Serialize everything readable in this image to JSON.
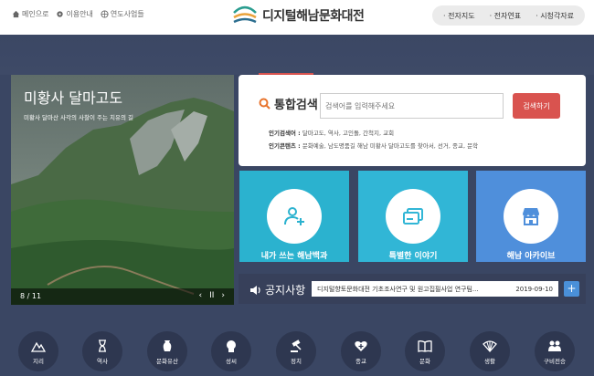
{
  "header": {
    "util": [
      "메인으로",
      "이용안내",
      "연도사업들"
    ],
    "logo_text": "디지털해남문화대전",
    "nav": [
      "· 전자지도",
      "· 전자연표",
      "· 시청각자료"
    ]
  },
  "slide": {
    "title": "미황사 달마고도",
    "subtitle": "미황사 달마산 사각의 사찰이 주는 치유의 길",
    "counter": "8 / 11",
    "prev": "‹",
    "pause": "II",
    "next": "›"
  },
  "search": {
    "label": "통합검색",
    "placeholder": "검색어를 입력해주세요",
    "button": "검색하기",
    "popular_words_label": "인기검색어 :",
    "popular_words": "달마고도, 역사, 고인돌, 간척지, 교회",
    "popular_contents_label": "인기콘텐츠 :",
    "popular_contents": "문화예술, 남도명품길 해남 미황사 달마고도를 찾아서, 선거, 종교, 문학"
  },
  "cards": [
    {
      "label": "내가 쓰는 해남백과",
      "color": "#2bb2cf",
      "icon": "person-plus-icon"
    },
    {
      "label": "특별한 이야기",
      "color": "#31b6d6",
      "icon": "cards-icon"
    },
    {
      "label": "해남 아카이브",
      "color": "#4f8fdb",
      "icon": "store-icon"
    }
  ],
  "notice": {
    "title": "공지사항",
    "text": "디지털향토문화대전 기초조사연구 및 원고집필사업 연구팀...",
    "date": "2019-09-10",
    "plus": "+"
  },
  "categories": [
    {
      "label": "지리",
      "icon": "mountain-icon"
    },
    {
      "label": "역사",
      "icon": "hourglass-icon"
    },
    {
      "label": "문화유산",
      "icon": "vase-icon"
    },
    {
      "label": "성씨",
      "icon": "head-icon"
    },
    {
      "label": "정치",
      "icon": "gavel-icon"
    },
    {
      "label": "종교",
      "icon": "heart-cross-icon"
    },
    {
      "label": "문화",
      "icon": "book-icon"
    },
    {
      "label": "생활",
      "icon": "fan-icon"
    },
    {
      "label": "구비전승",
      "icon": "people-icon"
    }
  ]
}
